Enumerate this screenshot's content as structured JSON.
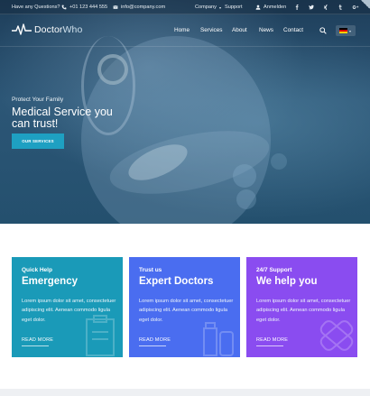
{
  "topbar": {
    "questions": "Have any Questions?",
    "phone": "+01 123 444 555",
    "email": "info@company.com",
    "company": "Company",
    "support": "Support",
    "login": "Anmelden",
    "social": [
      "facebook-icon",
      "twitter-icon",
      "xing-icon",
      "tumblr-icon",
      "google-plus-icon"
    ]
  },
  "brand": {
    "part1": "Doctor",
    "part2": "Who"
  },
  "nav": {
    "items": [
      "Home",
      "Services",
      "About",
      "News",
      "Contact"
    ]
  },
  "language": {
    "flag": "german-flag-icon",
    "colors": [
      "#000000",
      "#dd0000",
      "#ffce00"
    ]
  },
  "hero": {
    "kicker": "Protect Your Family",
    "title": "Medical Service you can trust!",
    "button": "OUR SERVICES"
  },
  "colors": {
    "accent": "#1ea0c2",
    "card1": "#1a9ab8",
    "card2": "#4a6df0",
    "card3": "#8a4cf0"
  },
  "cards": [
    {
      "kicker": "Quick Help",
      "title": "Emergency",
      "body": "Lorem ipsum dolor sit amet, consectetuer adipiscing elit. Aenean commodo ligula eget dolor.",
      "link": "READ MORE"
    },
    {
      "kicker": "Trust us",
      "title": "Expert Doctors",
      "body": "Lorem ipsum dolor sit amet, consectetuer adipiscing elit. Aenean commodo ligula eget dolor.",
      "link": "READ MORE"
    },
    {
      "kicker": "24/7 Support",
      "title": "We help you",
      "body": "Lorem ipsum dolor sit amet, consectetuer adipiscing elit. Aenean commodo ligula eget dolor.",
      "link": "READ MORE"
    }
  ]
}
